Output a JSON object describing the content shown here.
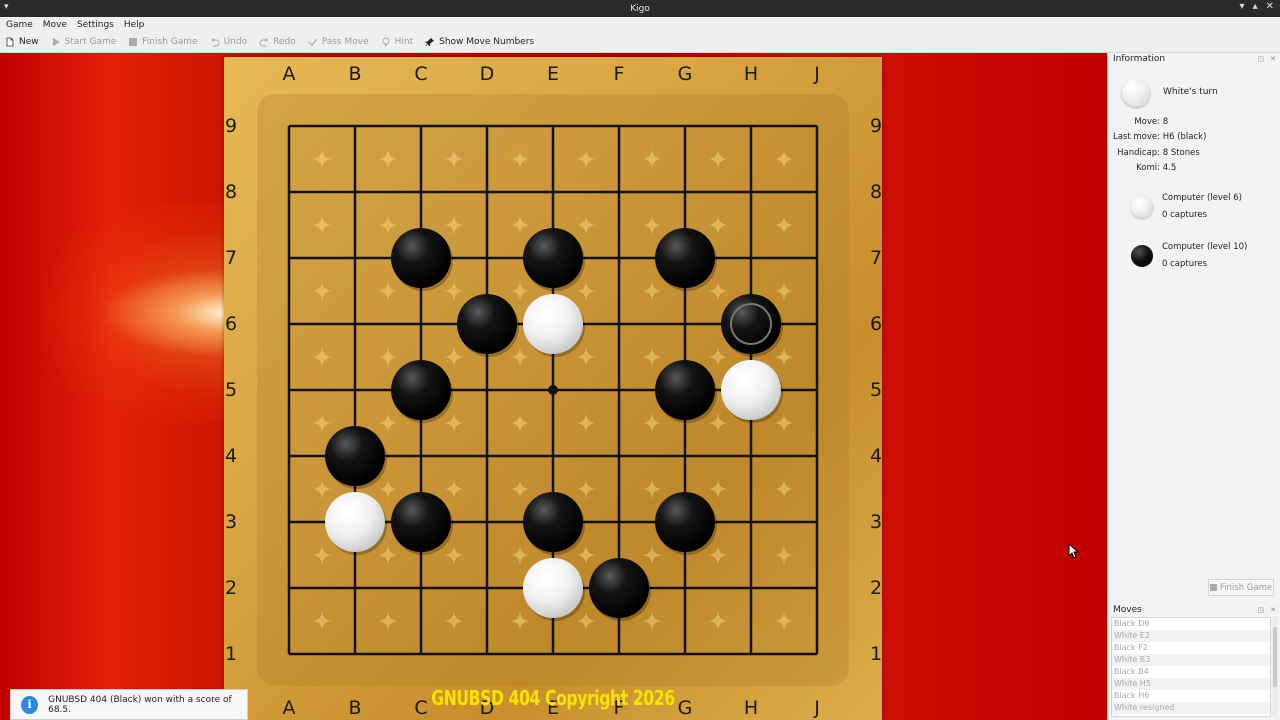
{
  "window": {
    "title": "Kigo",
    "controls": [
      "▾",
      "▴",
      "✕"
    ]
  },
  "menu": [
    "Game",
    "Move",
    "Settings",
    "Help"
  ],
  "toolbar": {
    "items": [
      {
        "label": "New",
        "icon": "new-document-icon",
        "enabled": true
      },
      {
        "label": "Start Game",
        "icon": "play-icon",
        "enabled": false
      },
      {
        "label": "Finish Game",
        "icon": "stop-icon",
        "enabled": false
      },
      {
        "label": "Undo",
        "icon": "undo-icon",
        "enabled": false
      },
      {
        "label": "Redo",
        "icon": "redo-icon",
        "enabled": false
      },
      {
        "label": "Pass Move",
        "icon": "pass-icon",
        "enabled": false
      },
      {
        "label": "Hint",
        "icon": "hint-icon",
        "enabled": false
      },
      {
        "label": "Show Move Numbers",
        "icon": "pin-icon",
        "enabled": true
      }
    ]
  },
  "board": {
    "size": 9,
    "columns": [
      "A",
      "B",
      "C",
      "D",
      "E",
      "F",
      "G",
      "H",
      "J"
    ],
    "bottom_columns": [
      "A",
      "B",
      "C",
      "D",
      "E",
      "F",
      "G",
      "H",
      "J"
    ],
    "rows": [
      "9",
      "8",
      "7",
      "6",
      "5",
      "4",
      "3",
      "2",
      "1"
    ],
    "star_point": "E5",
    "stones": [
      {
        "point": "C7",
        "color": "black"
      },
      {
        "point": "E7",
        "color": "black"
      },
      {
        "point": "G7",
        "color": "black"
      },
      {
        "point": "D6",
        "color": "black"
      },
      {
        "point": "E6",
        "color": "white"
      },
      {
        "point": "H6",
        "color": "black",
        "last_move": true
      },
      {
        "point": "C5",
        "color": "black"
      },
      {
        "point": "G5",
        "color": "black"
      },
      {
        "point": "H5",
        "color": "white"
      },
      {
        "point": "B4",
        "color": "black"
      },
      {
        "point": "B3",
        "color": "white"
      },
      {
        "point": "C3",
        "color": "black"
      },
      {
        "point": "E3",
        "color": "black"
      },
      {
        "point": "G3",
        "color": "black"
      },
      {
        "point": "E2",
        "color": "white"
      },
      {
        "point": "F2",
        "color": "black"
      }
    ],
    "watermark": "GNUBSD 404 Copyright 2026"
  },
  "notification": {
    "icon": "info-icon",
    "text": "GNUBSD 404 (Black) won with a score of 68.5."
  },
  "info_panel": {
    "title": "Information",
    "turn": "White's turn",
    "details": [
      {
        "label": "Move:",
        "value": "8"
      },
      {
        "label": "Last move:",
        "value": "H6 (black)"
      },
      {
        "label": "Handicap:",
        "value": "8 Stones"
      },
      {
        "label": "Komi:",
        "value": "4.5"
      }
    ],
    "players": [
      {
        "color": "white",
        "name": "Computer (level 6)",
        "captures": "0 captures"
      },
      {
        "color": "black",
        "name": "Computer (level 10)",
        "captures": "0 captures"
      }
    ],
    "finish_button": "Finish Game"
  },
  "moves_panel": {
    "title": "Moves",
    "items": [
      "Black D6",
      "White E2",
      "Black F2",
      "White B3",
      "Black B4",
      "White H5",
      "Black H6",
      "White resigned"
    ]
  }
}
